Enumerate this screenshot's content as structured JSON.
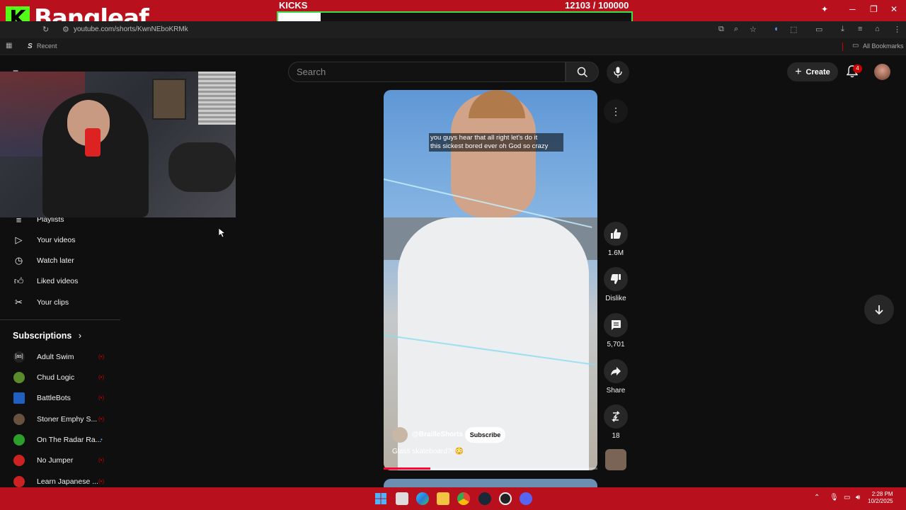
{
  "overlay": {
    "brand": "Bangleaf",
    "brand_letter": "K",
    "goal_label": "KICKS",
    "goal_count": "12103  / 100000",
    "goal_progress": 0.121
  },
  "browser": {
    "url": "youtube.com/shorts/KwnNEboKRMk",
    "recent_label": "Recent",
    "all_bookmarks": "All Bookmarks"
  },
  "header": {
    "search_placeholder": "Search",
    "create_label": "Create",
    "notification_count": "4"
  },
  "sidebar": {
    "items": [
      {
        "label": "Playlists",
        "icon": "playlist-icon"
      },
      {
        "label": "Your videos",
        "icon": "video-icon"
      },
      {
        "label": "Watch later",
        "icon": "clock-icon"
      },
      {
        "label": "Liked videos",
        "icon": "thumbs-up-icon"
      },
      {
        "label": "Your clips",
        "icon": "scissors-icon"
      }
    ],
    "subscriptions_title": "Subscriptions",
    "subscriptions": [
      {
        "name": "Adult Swim",
        "color": "#222222"
      },
      {
        "name": "Chud Logic",
        "color": "#5a8c2a"
      },
      {
        "name": "BattleBots",
        "color": "#2060c0"
      },
      {
        "name": "Stoner Emphy S...",
        "color": "#6a5040"
      },
      {
        "name": "On The Radar Ra...",
        "color": "#2aa02a"
      },
      {
        "name": "No Jumper",
        "color": "#cc2222"
      },
      {
        "name": "Learn Japanese ...",
        "color": "#cc2222"
      }
    ]
  },
  "video": {
    "caption_line1": "you guys hear that all right let's do it",
    "caption_line2": "this sickest bored ever oh God so crazy",
    "channel": "@BrailleShorts",
    "subscribe_label": "Subscribe",
    "title": "Glass skateboard?! 😳",
    "progress": 0.22
  },
  "actions": {
    "likes": "1.6M",
    "dislike_label": "Dislike",
    "comments": "5,701",
    "share_label": "Share",
    "remix_count": "18"
  },
  "taskbar": {
    "time": "2:28 PM",
    "date": "10/2/2025"
  }
}
